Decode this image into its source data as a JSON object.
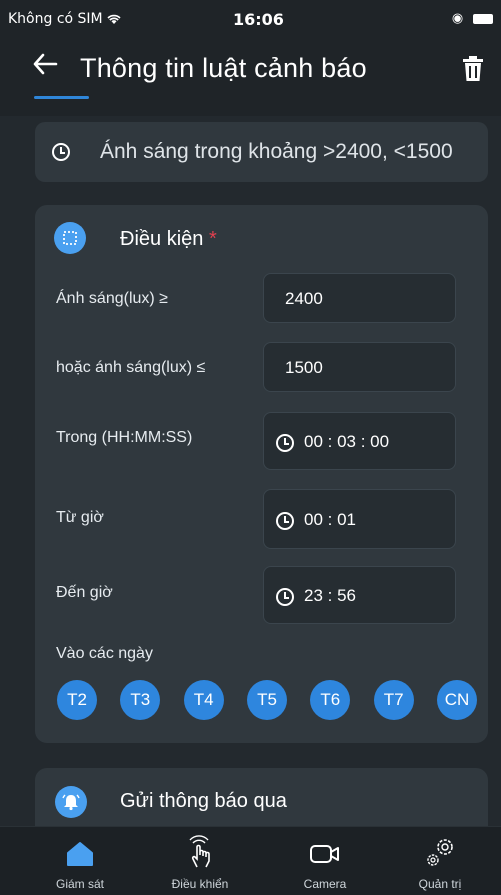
{
  "status": {
    "carrier": "Không có SIM",
    "time": "16:06"
  },
  "header": {
    "title": "Thông tin luật cảnh báo",
    "back_icon": "back-arrow-icon",
    "delete_icon": "trash-icon"
  },
  "summary": {
    "text": "Ánh sáng trong khoảng >2400, <1500"
  },
  "condition": {
    "title": "Điều kiện",
    "required_mark": "*",
    "light_ge_label": "Ánh sáng(lux) ≥",
    "light_ge_value": "2400",
    "light_le_label": "hoặc ánh sáng(lux) ≤",
    "light_le_value": "1500",
    "duration_label": "Trong (HH:MM:SS)",
    "duration_value": "00 : 03 : 00",
    "from_label": "Từ giờ",
    "from_value": "00 : 01",
    "to_label": "Đến giờ",
    "to_value": "23 : 56",
    "days_label": "Vào các ngày",
    "days": [
      "T2",
      "T3",
      "T4",
      "T5",
      "T6",
      "T7",
      "CN"
    ]
  },
  "notify": {
    "title": "Gửi thông báo qua"
  },
  "tabs": [
    {
      "label": "Giám sát",
      "icon": "home-icon"
    },
    {
      "label": "Điều khiển",
      "icon": "touch-icon"
    },
    {
      "label": "Camera",
      "icon": "camera-icon"
    },
    {
      "label": "Quản trị",
      "icon": "settings-icon"
    }
  ],
  "colors": {
    "accent": "#2e86de",
    "background": "#23292e",
    "card": "#30383e",
    "required": "#e0404f"
  }
}
